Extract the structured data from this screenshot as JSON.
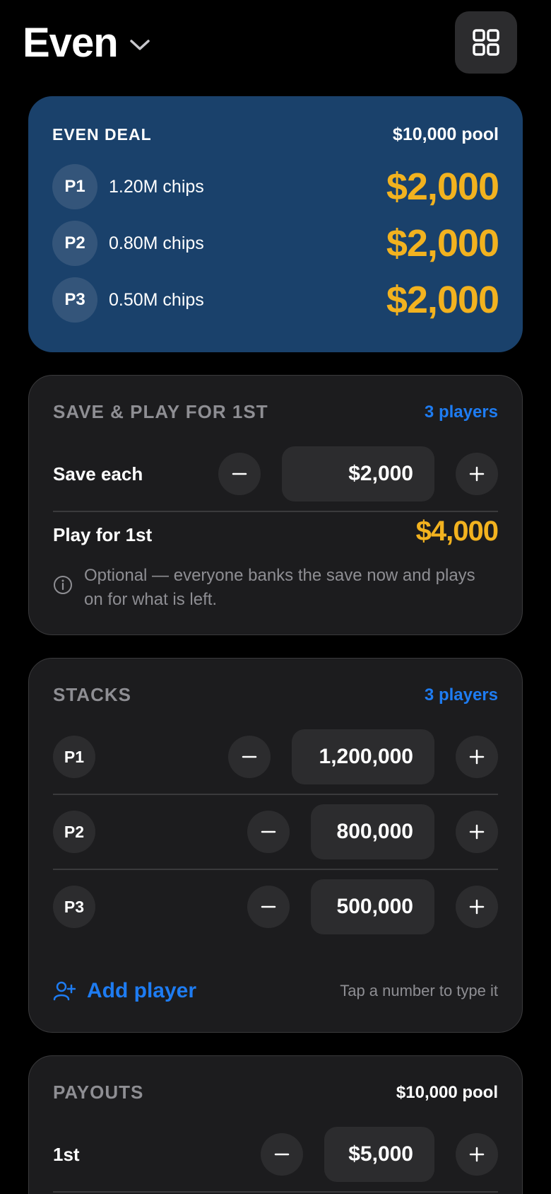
{
  "header": {
    "title": "Even",
    "chevron_icon": "chevron-down-icon",
    "menu_icon": "grid-icon"
  },
  "deal": {
    "label": "EVEN DEAL",
    "pool": "$10,000 pool",
    "rows": [
      {
        "player": "P1",
        "chips": "1.20M chips",
        "amount": "$2,000"
      },
      {
        "player": "P2",
        "chips": "0.80M chips",
        "amount": "$2,000"
      },
      {
        "player": "P3",
        "chips": "0.50M chips",
        "amount": "$2,000"
      }
    ]
  },
  "save": {
    "label": "SAVE & PLAY FOR 1ST",
    "players": "3 players",
    "save_each_label": "Save each",
    "save_each_value": "$2,000",
    "play_label": "Play for 1st",
    "play_amount": "$4,000",
    "info": "Optional — everyone banks the save now and plays on for what is left."
  },
  "stacks": {
    "label": "STACKS",
    "players": "3 players",
    "rows": [
      {
        "player": "P1",
        "value": "1,200,000"
      },
      {
        "player": "P2",
        "value": "800,000"
      },
      {
        "player": "P3",
        "value": "500,000"
      }
    ],
    "add_label": "Add player",
    "hint": "Tap a number to type it"
  },
  "payouts": {
    "label": "PAYOUTS",
    "pool": "$10,000 pool",
    "rows": [
      {
        "place": "1st",
        "value": "$5,000"
      }
    ]
  },
  "colors": {
    "background": "#000000",
    "card": "#1c1c1e",
    "deal_card": "#1a416b",
    "accent_gold": "#f2b21f",
    "accent_blue": "#1e7cf2",
    "muted": "#8e8e93"
  }
}
